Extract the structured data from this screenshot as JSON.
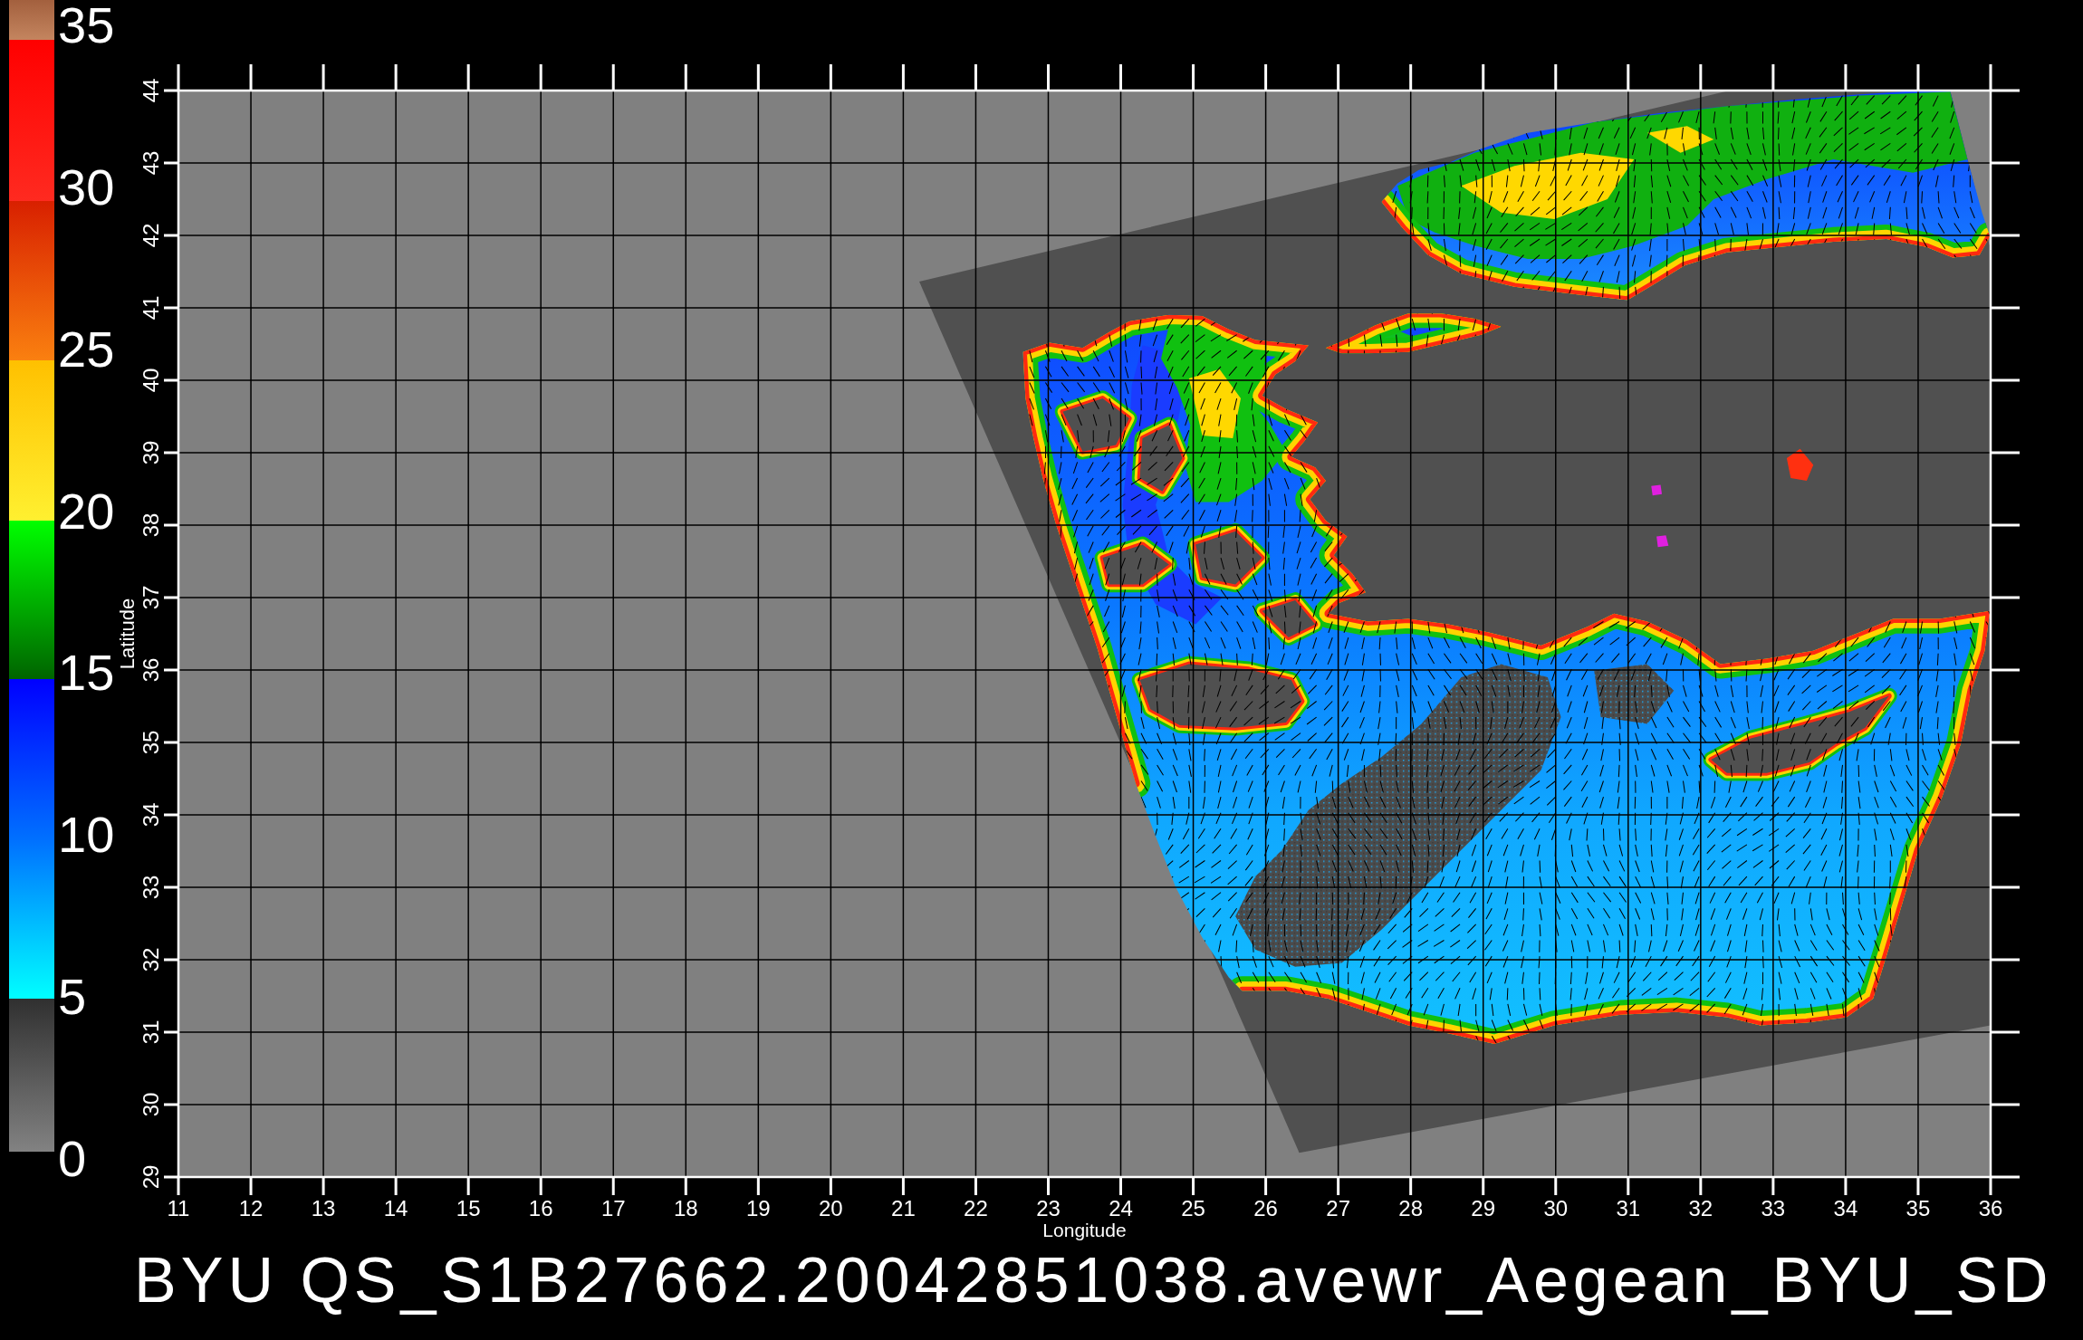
{
  "colorbar": {
    "labels": [
      "35",
      "30",
      "25",
      "20",
      "15",
      "10",
      "5",
      "0"
    ]
  },
  "map": {
    "ylabel": "Latitude",
    "yticks": [
      "29",
      "30",
      "31",
      "32",
      "33",
      "34",
      "35",
      "36",
      "37",
      "38",
      "39",
      "40",
      "41",
      "42",
      "43",
      "44"
    ],
    "xlabel": "Longitude",
    "xticks": [
      "11",
      "12",
      "13",
      "14",
      "15",
      "16",
      "17",
      "18",
      "19",
      "20",
      "21",
      "22",
      "23",
      "24",
      "25",
      "26",
      "27",
      "28",
      "29",
      "30",
      "31",
      "32",
      "33",
      "34",
      "35",
      "36"
    ]
  },
  "title": "BYU QS_S1B27662.20042851038.avewr_Aegean_BYU_SD"
}
